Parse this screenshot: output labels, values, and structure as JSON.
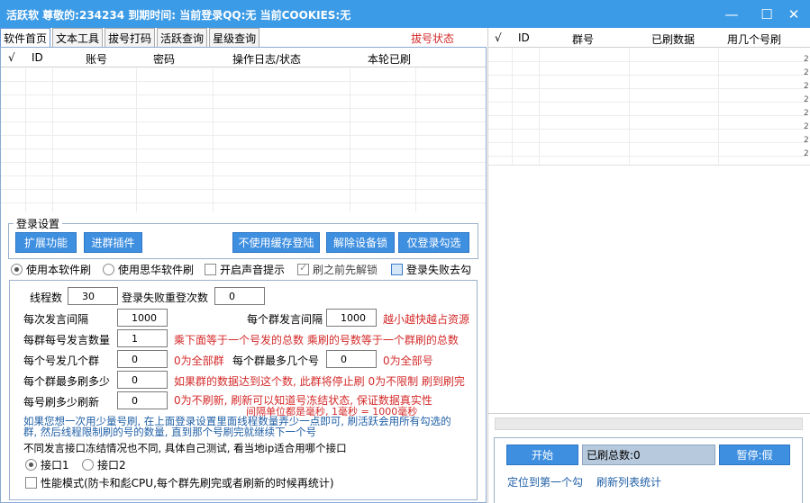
{
  "titlebar": {
    "title": "活跃软 尊敬的:234234 到期时间: 当前登录QQ:无 当前COOKIES:无",
    "minimize": "—",
    "maximize": "☐",
    "close": "✕"
  },
  "tabs": [
    {
      "label": "软件首页"
    },
    {
      "label": "文本工具"
    },
    {
      "label": "拔号打码"
    },
    {
      "label": "活跃查询"
    },
    {
      "label": "星级查询"
    }
  ],
  "tab_status": "拔号状态",
  "account_table": {
    "columns": [
      "√",
      "ID",
      "账号",
      "密码",
      "操作日志/状态",
      "本轮已刷"
    ]
  },
  "login_group": {
    "label": "登录设置",
    "buttons": {
      "extend": "扩展功能",
      "join_plugin": "进群插件",
      "no_cache": "不使用缓存登陆",
      "unlock_device": "解除设备锁",
      "login_checked": "仅登录勾选"
    }
  },
  "options": {
    "use_this": "使用本软件刷",
    "use_sihua": "使用思华软件刷",
    "sound": "开启声音提示",
    "unfreeze": "刷之前先解锁",
    "fail_uncheck": "登录失败去勾"
  },
  "settings": {
    "thread_label": "线程数",
    "thread_value": "30",
    "retry_label": "登录失败重登次数",
    "retry_value": "0",
    "speak_interval_label": "每次发言间隔",
    "speak_interval_value": "1000",
    "group_interval_label": "每个群发言间隔",
    "group_interval_value": "1000",
    "group_interval_note": "越小越快越占资源",
    "per_group_label": "每群每号发言数量",
    "per_group_value": "1",
    "per_group_note": "乘下面等于一个号发的总数  乘刷的号数等于一个群刷的总数",
    "per_account_groups_label": "每个号发几个群",
    "per_account_groups_value": "0",
    "per_account_groups_note": "0为全部群",
    "max_accounts_label": "每个群最多几个号",
    "max_accounts_value": "0",
    "max_accounts_note": "0为全部号",
    "group_max_label": "每个群最多刷多少",
    "group_max_value": "0",
    "group_max_note": "如果群的数据达到这个数, 此群将停止刷  0为不限制  刷到刷完",
    "refresh_label": "每号刷多少刷新",
    "refresh_value": "0",
    "refresh_note": "0为不刷新, 刷新可以知道号冻结状态, 保证数据真实性",
    "unit_note": "间隔单位都是毫秒, 1毫秒 = 1000毫秒",
    "tip": "如果您想一次用少量号刷, 在上面登录设置里面线程数量弄少一点即可, 刷活跃会用所有勾选的群, 然后线程限制刷的号的数量, 直到那个号刷完就继续下一个号",
    "interface_note": "不同发言接口冻结情况也不同, 具体自己测试, 看当地ip适合用哪个接口",
    "interface1": "接口1",
    "interface2": "接口2",
    "perf_mode": "性能模式(防卡和彪CPU,每个群先刷完或者刷新的时候再统计)"
  },
  "group_table": {
    "columns": [
      "√",
      "ID",
      "群号",
      "已刷数据",
      "用几个号刷"
    ],
    "row_marker": "2"
  },
  "bottom": {
    "start": "开始",
    "total": "已刷总数:0",
    "pause": "暂停:假",
    "locate": "定位到第一个勾",
    "refresh_stats": "刷新列表统计"
  }
}
